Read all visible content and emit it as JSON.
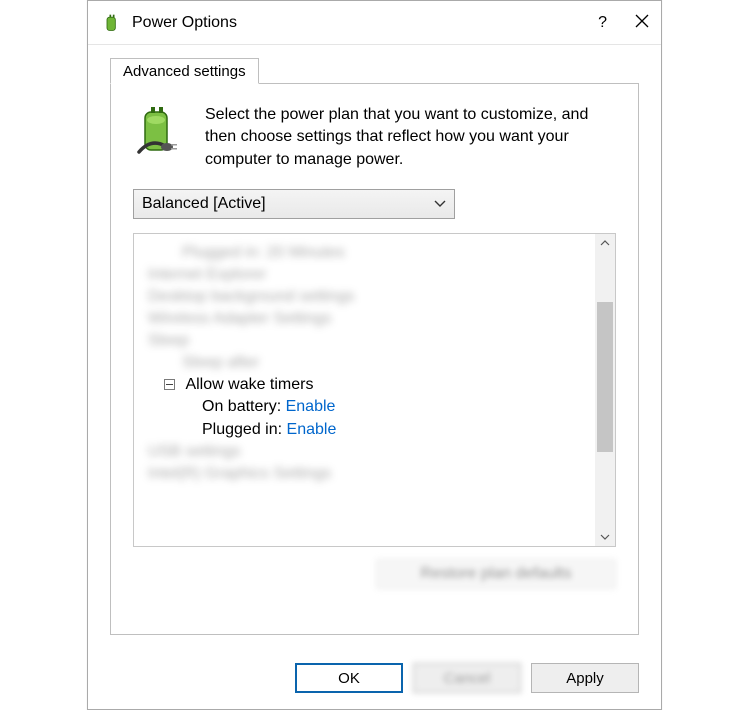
{
  "title": "Power Options",
  "tab_label": "Advanced settings",
  "intro": "Select the power plan that you want to customize, and then choose settings that reflect how you want your computer to manage power.",
  "plan_dropdown": {
    "selected": "Balanced [Active]"
  },
  "tree": {
    "blurred_above": [
      {
        "indent": "ind1",
        "text": "Plugged in:  20 Minutes"
      },
      {
        "indent": "ind0",
        "text": "Internet Explorer"
      },
      {
        "indent": "ind0",
        "text": "Desktop background settings"
      },
      {
        "indent": "ind0",
        "text": "Wireless Adapter Settings"
      },
      {
        "indent": "ind0",
        "text": "Sleep"
      },
      {
        "indent": "ind1",
        "text": "Sleep after"
      }
    ],
    "node": {
      "label": "Allow wake timers",
      "children": [
        {
          "label": "On battery",
          "value": "Enable"
        },
        {
          "label": "Plugged in",
          "value": "Enable"
        }
      ]
    },
    "blurred_below": [
      {
        "indent": "ind0",
        "text": "USB settings"
      },
      {
        "indent": "ind0",
        "text": "Intel(R) Graphics Settings"
      }
    ]
  },
  "restore_label": "Restore plan defaults",
  "buttons": {
    "ok": "OK",
    "cancel": "Cancel",
    "apply": "Apply"
  }
}
